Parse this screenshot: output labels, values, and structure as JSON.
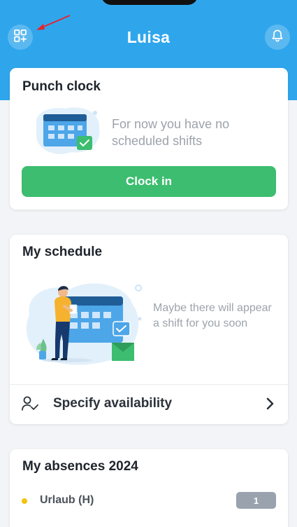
{
  "header": {
    "title": "Luisa",
    "left_icon": "apps-add-icon",
    "right_icon": "bell-icon",
    "color": "#2fa6ec"
  },
  "punch_clock": {
    "title": "Punch clock",
    "message": "For now you have no scheduled shifts",
    "button_label": "Clock in",
    "button_color": "#3cbd6f"
  },
  "schedule": {
    "title": "My schedule",
    "message": "Maybe there will appear a shift for you soon",
    "availability_label": "Specify availability",
    "availability_icon": "user-check-icon",
    "chevron_icon": "chevron-right-icon"
  },
  "absences": {
    "title": "My absences 2024",
    "items": [
      {
        "label": "Urlaub (H)",
        "count": "1",
        "dot_color": "#f2c40f"
      }
    ]
  }
}
